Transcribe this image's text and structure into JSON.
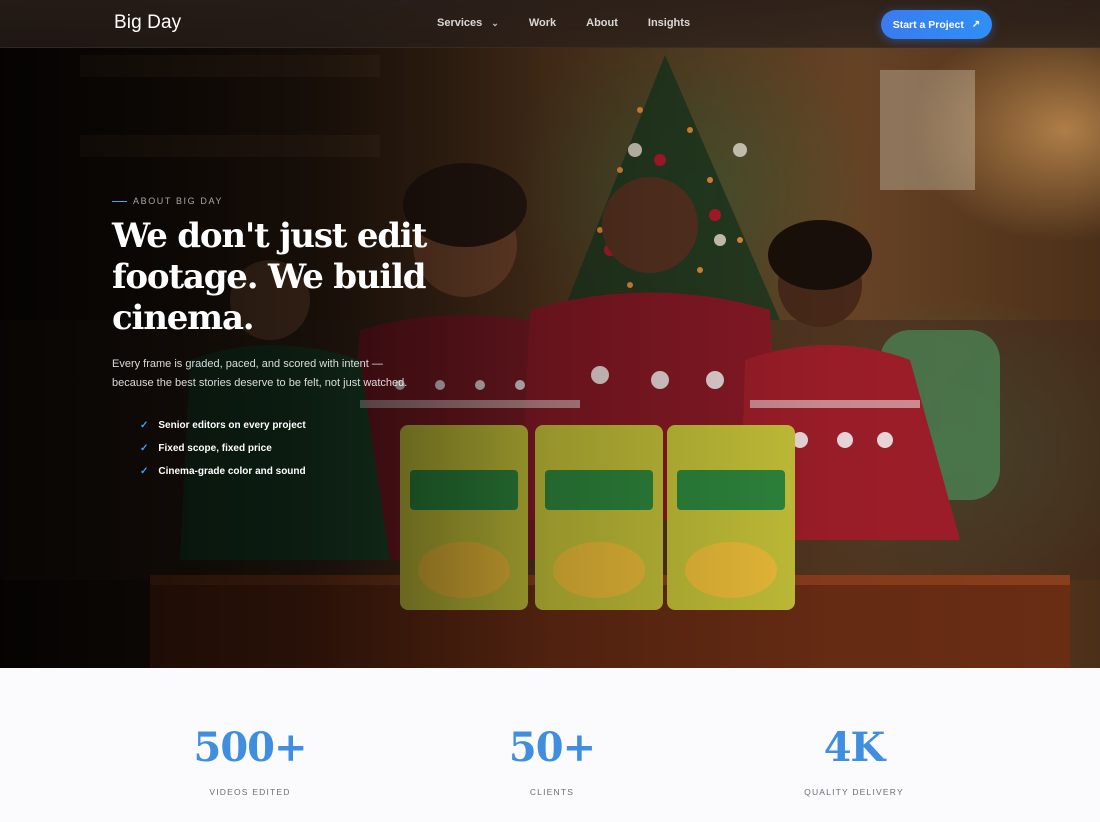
{
  "nav": {
    "brand": "Big Day",
    "links": [
      {
        "label": "Services",
        "has_dropdown": true
      },
      {
        "label": "Work"
      },
      {
        "label": "About"
      },
      {
        "label": "Insights"
      }
    ],
    "cta_label": "Start a Project",
    "cta_icon": "arrow-up-right-icon"
  },
  "hero": {
    "eyebrow": "ABOUT BIG DAY",
    "headline_lines": [
      "We don't just edit",
      "footage. We build",
      "cinema."
    ],
    "subcopy_lines": [
      "Every frame is graded, paced, and scored with intent —",
      "because the best stories deserve to be felt, not just watched."
    ],
    "features": [
      "Senior editors on every project",
      "Fixed scope, fixed price",
      "Cinema-grade color and sound"
    ],
    "background_image": "family-christmas-couch-snack-bags"
  },
  "stats": [
    {
      "value": "500+",
      "label": "VIDEOS EDITED"
    },
    {
      "value": "50+",
      "label": "CLIENTS"
    },
    {
      "value": "4K",
      "label": "QUALITY DELIVERY"
    }
  ],
  "colors": {
    "accent": "#3f8ee0",
    "cta_start": "#3a7bf0",
    "cta_end": "#2f8ff5",
    "stats_background": "#fbfafc"
  }
}
